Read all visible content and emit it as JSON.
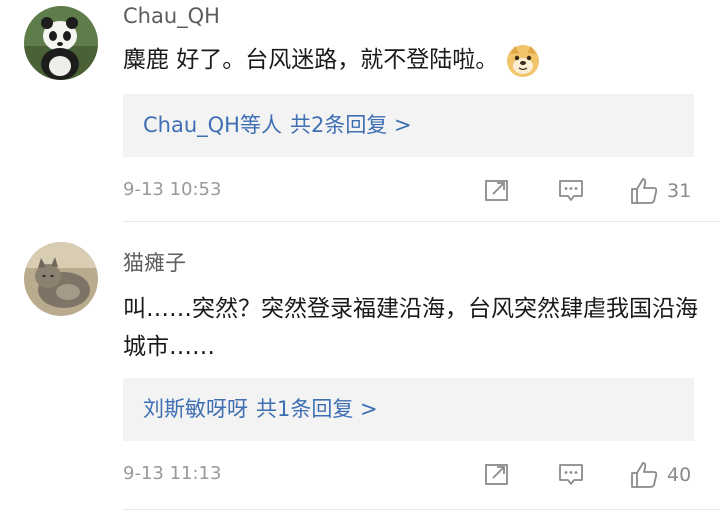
{
  "comments": [
    {
      "username": "Chau_QH",
      "text": "麋鹿 好了。台风迷路，就不登陆啦。",
      "emoji": "doge-emoji",
      "reply_box": {
        "who": "Chau_QH等人",
        "count": "共2条回复 >"
      },
      "time": "9-13 10:53",
      "likes": "31"
    },
    {
      "username": "猫瘫子",
      "text": "叫……突然？突然登录福建沿海，台风突然肆虐我国沿海城市……",
      "reply_box": {
        "who": "刘斯敏呀呀",
        "count": "共1条回复 >"
      },
      "time": "9-13 11:13",
      "likes": "40"
    }
  ],
  "colors": {
    "link": "#3f6fb3",
    "meta": "#9a9a9a",
    "reply_bg": "#f3f3f3"
  }
}
